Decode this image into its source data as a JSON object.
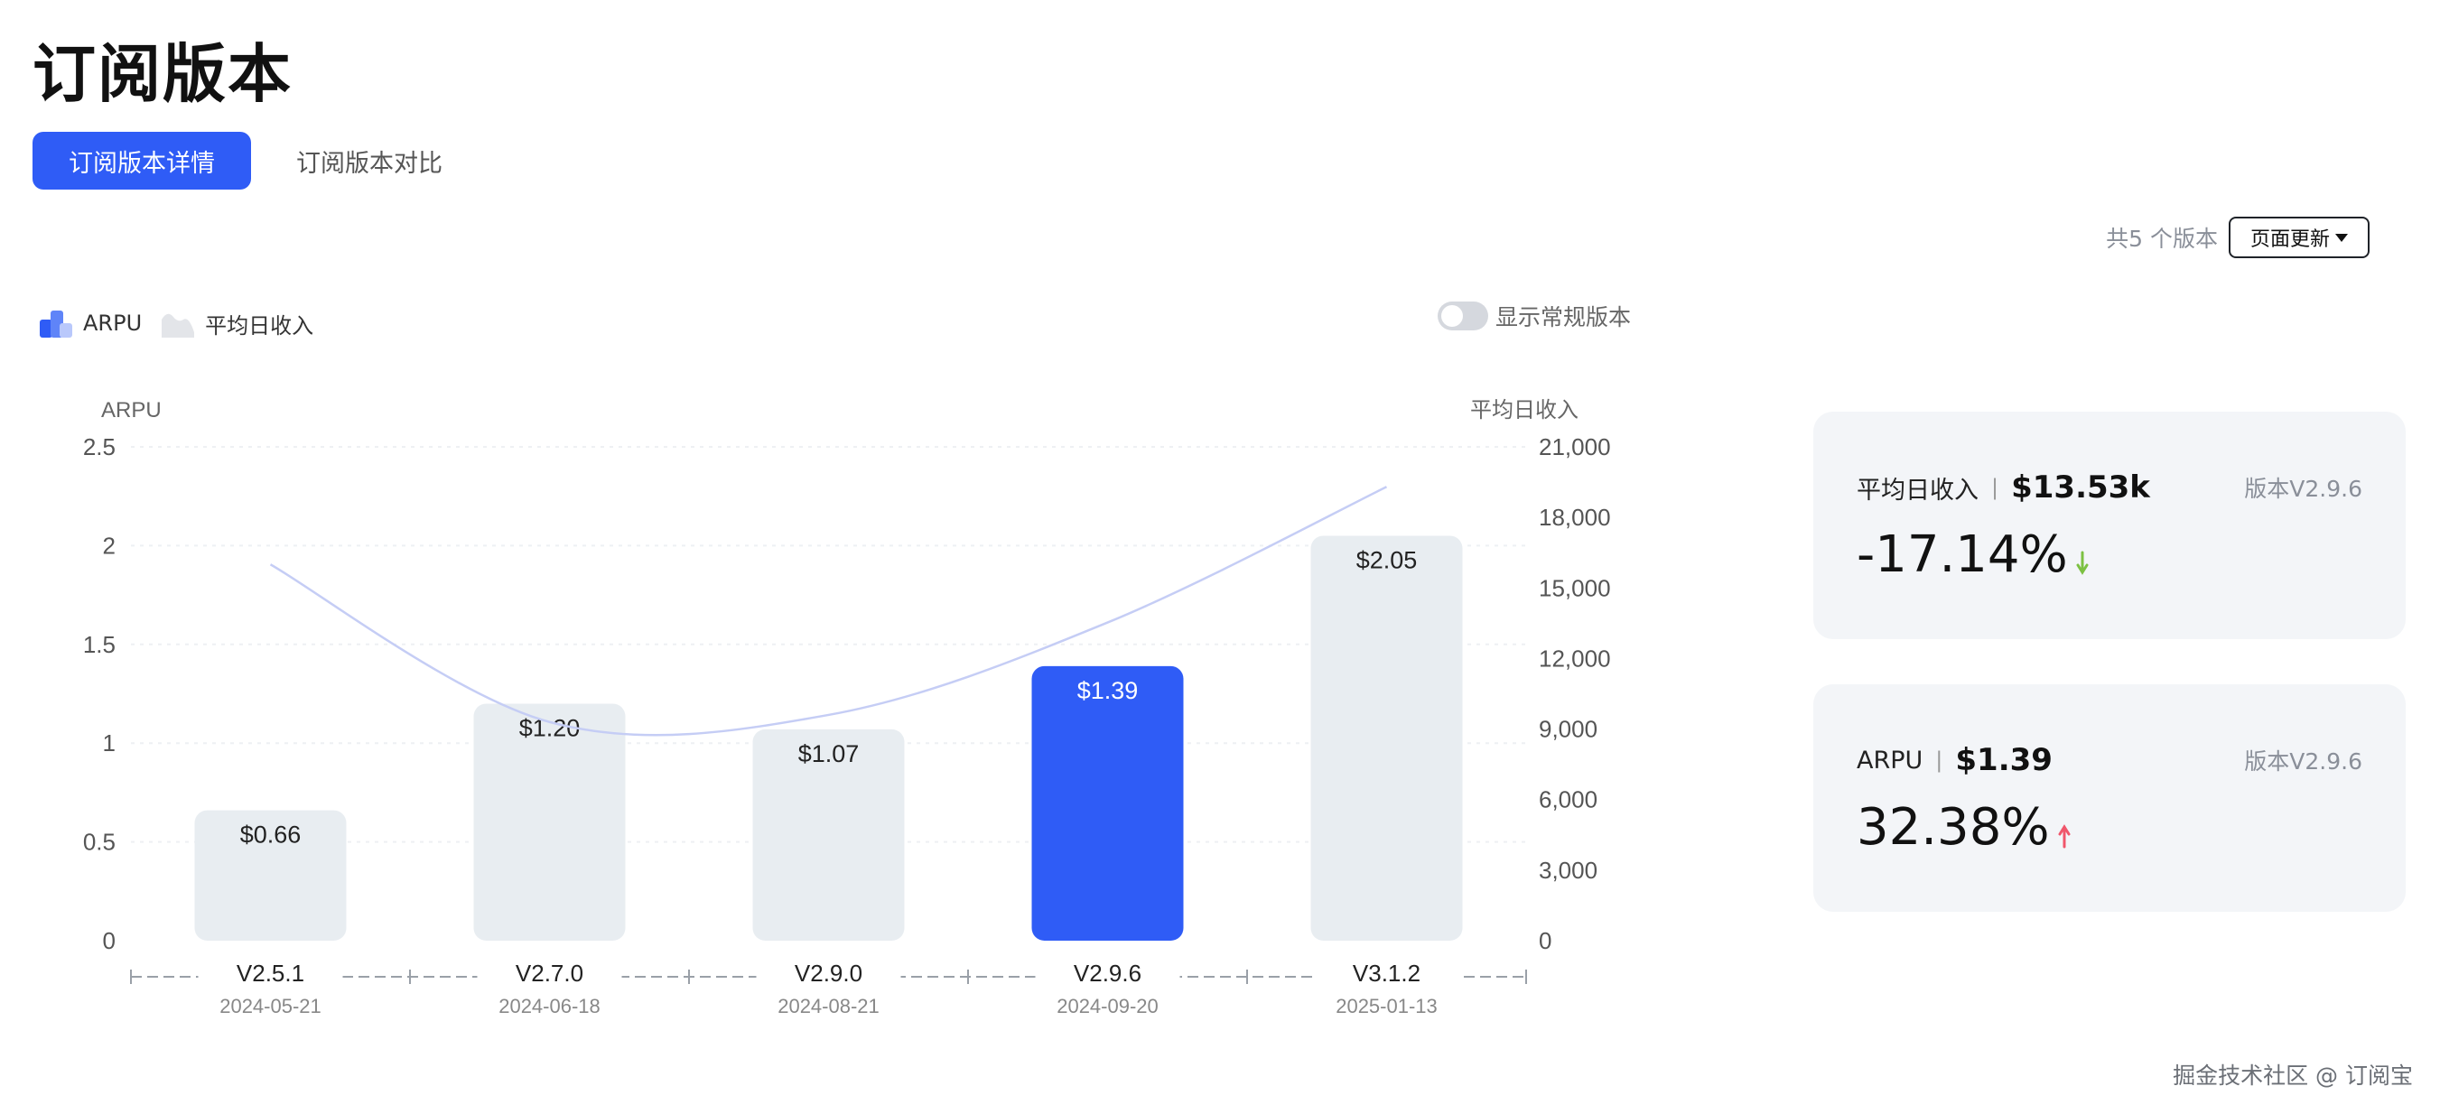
{
  "header": {
    "title": "订阅版本"
  },
  "tabs": [
    {
      "label": "订阅版本详情",
      "active": true
    },
    {
      "label": "订阅版本对比",
      "active": false
    }
  ],
  "toolbar": {
    "count_text": "共5 个版本",
    "update_label": "页面更新"
  },
  "legend": {
    "arpu_label": "ARPU",
    "revenue_label": "平均日收入"
  },
  "toggle": {
    "label": "显示常规版本",
    "on": false
  },
  "chart_data": {
    "type": "bar",
    "categories": [
      "V2.5.1",
      "V2.7.0",
      "V2.9.0",
      "V2.9.6",
      "V3.1.2"
    ],
    "dates": [
      "2024-05-21",
      "2024-06-18",
      "2024-08-21",
      "2024-09-20",
      "2025-01-13"
    ],
    "series": [
      {
        "name": "ARPU",
        "type": "bar",
        "axis": "left",
        "values": [
          0.66,
          1.2,
          1.07,
          1.39,
          2.05
        ],
        "labels": [
          "$0.66",
          "$1.20",
          "$1.07",
          "$1.39",
          "$2.05"
        ]
      },
      {
        "name": "平均日收入",
        "type": "line",
        "axis": "right",
        "values": [
          16000,
          9300,
          9600,
          13530,
          19300
        ]
      }
    ],
    "highlight_index": 3,
    "y_left": {
      "label": "ARPU",
      "lim": [
        0,
        2.5
      ],
      "ticks": [
        "0",
        "0.5",
        "1",
        "1.5",
        "2",
        "2.5"
      ],
      "tick_values": [
        0,
        0.5,
        1,
        1.5,
        2,
        2.5
      ]
    },
    "y_right": {
      "label": "平均日收入",
      "lim": [
        0,
        21000
      ],
      "ticks": [
        "0",
        "3,000",
        "6,000",
        "9,000",
        "12,000",
        "15,000",
        "18,000",
        "21,000"
      ],
      "tick_values": [
        0,
        3000,
        6000,
        9000,
        12000,
        15000,
        18000,
        21000
      ]
    },
    "colors": {
      "bar": "#e8edf1",
      "highlight": "#2f5cf6",
      "line": "#c5cdf5",
      "grid": "#eef0f3"
    },
    "grid": true
  },
  "cards": [
    {
      "label": "平均日收入",
      "value": "$13.53k",
      "version": "版本V2.9.6",
      "pct": "-17.14%",
      "trend": "down",
      "trend_color": "#7cc142"
    },
    {
      "label": "ARPU",
      "value": "$1.39",
      "version": "版本V2.9.6",
      "pct": "32.38%",
      "trend": "up",
      "trend_color": "#f0566b"
    }
  ],
  "footer": {
    "watermark": "掘金技术社区 @ 订阅宝"
  }
}
